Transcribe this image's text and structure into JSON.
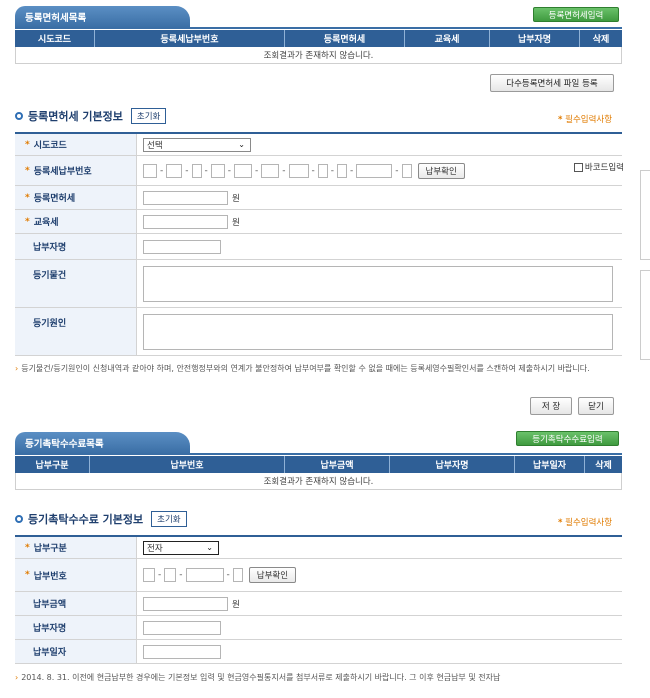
{
  "reg_list": {
    "title": "등록면허세목록",
    "input_button": "등록면허세입력",
    "columns": [
      "시도코드",
      "등록세납부번호",
      "등록면허세",
      "교육세",
      "납부자명",
      "삭제"
    ],
    "empty_message": "조회결과가 존재하지 않습니다.",
    "bulk_button": "다수등록면허세 파일 등록"
  },
  "reg_form": {
    "title": "등록면허세 기본정보",
    "reset_button": "초기화",
    "required_note_mark": "*",
    "required_note": "필수입력사항",
    "fields": {
      "sido": "시도코드",
      "sido_value": "선택",
      "payno": "등록세납부번호",
      "confirm_button": "납부확인",
      "barcode": "바코드입력",
      "amount": "등록면허세",
      "amount_unit": "원",
      "edu": "교육세",
      "edu_unit": "원",
      "payer": "납부자명",
      "item": "등기물건",
      "cause": "등기원인"
    },
    "note": "등기물건/등기원인이 신청내역과 같아야 하며, 안전행정부와의 연계가 불안정하여 납부여부를 확인할 수 없을 때에는 등록세영수필확인서를 스캔하여 제출하시기 바랍니다.",
    "save_button": "저 장",
    "close_button": "닫기"
  },
  "fee_list": {
    "title": "등기촉탁수수료목록",
    "input_button": "등기촉탁수수료입력",
    "columns": [
      "납부구분",
      "납부번호",
      "납부금액",
      "납부자명",
      "납부일자",
      "삭제"
    ],
    "empty_message": "조회결과가 존재하지 않습니다."
  },
  "fee_form": {
    "title": "등기촉탁수수료 기본정보",
    "reset_button": "초기화",
    "required_note_mark": "*",
    "required_note": "필수입력사항",
    "fields": {
      "type": "납부구분",
      "type_value": "전자",
      "payno": "납부번호",
      "confirm_button": "납부확인",
      "amount": "납부금액",
      "amount_unit": "원",
      "payer": "납부자명",
      "date": "납부일자"
    },
    "note": "2014. 8. 31. 이전에 현금납부한 경우에는 기본정보 입력 및 현금영수필통지서를 첨부서류로 제출하시기 바랍니다. 그 이후 현금납부 및 전자납"
  }
}
